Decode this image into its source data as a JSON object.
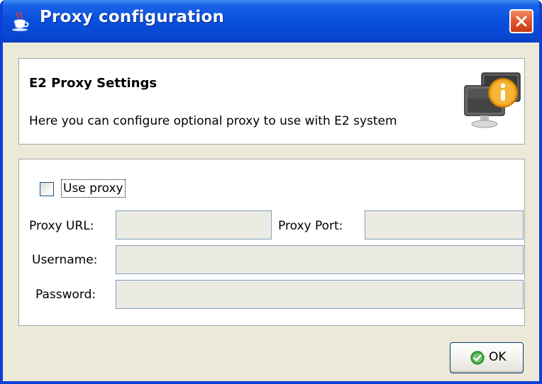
{
  "window": {
    "title": "Proxy configuration",
    "title_icon": "java-coffee-icon",
    "close_icon": "close-icon"
  },
  "header": {
    "title": "E2 Proxy Settings",
    "description": "Here you can configure optional proxy to use with E2 system",
    "icon": "info-monitor-icon"
  },
  "form": {
    "use_proxy": {
      "label": "Use proxy",
      "checked": false
    },
    "proxy_url": {
      "label": "Proxy URL:",
      "value": "",
      "enabled": false
    },
    "proxy_port": {
      "label": "Proxy Port:",
      "value": "",
      "enabled": false
    },
    "username": {
      "label": "Username:",
      "value": "",
      "enabled": false
    },
    "password": {
      "label": "Password:",
      "value": "",
      "enabled": false
    }
  },
  "buttons": {
    "ok_label": "OK",
    "ok_icon": "check-circle-icon"
  },
  "colors": {
    "titlebar": "#0a50de",
    "window_bg": "#ece9d8",
    "close_button": "#e2562c",
    "disabled_field": "#ebebe4",
    "field_border": "#7f9db9"
  }
}
